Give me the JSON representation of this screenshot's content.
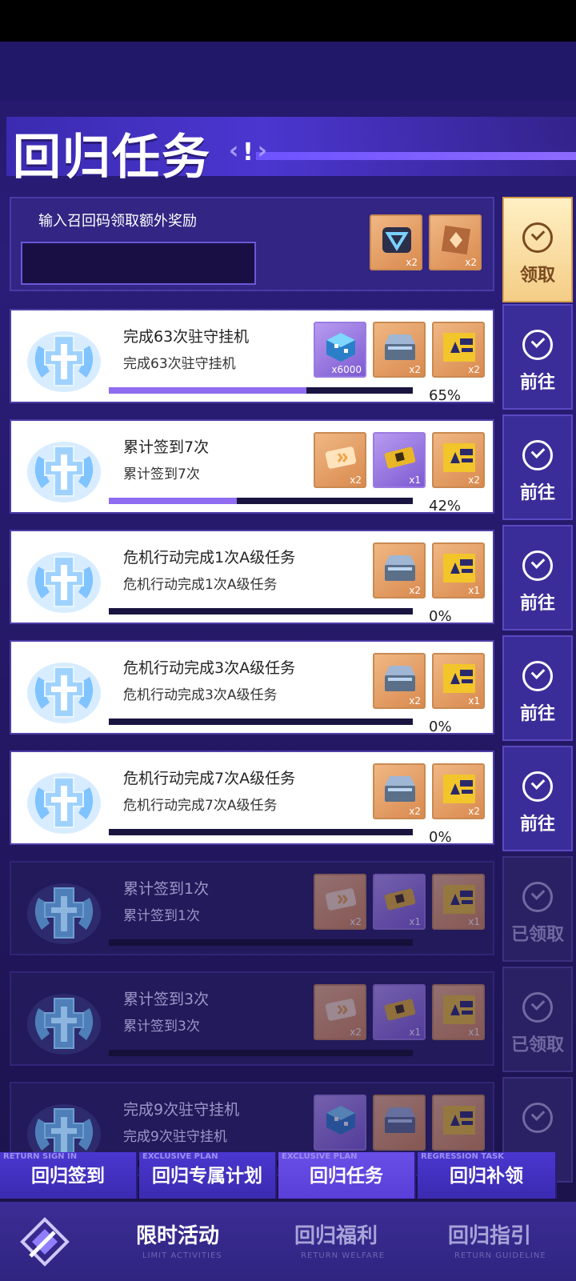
{
  "page": {
    "title": "回归任务",
    "title_icon": "exclamation-icon"
  },
  "code": {
    "label": "输入召回码领取额外奖励",
    "value": "",
    "placeholder": ""
  },
  "code_rewards": [
    {
      "icon": "crest-token-icon",
      "qty": "x2"
    },
    {
      "icon": "badge-card-icon",
      "qty": "x2"
    }
  ],
  "code_button": {
    "label": "领取"
  },
  "tasks": [
    {
      "title": "完成63次驻守挂机",
      "subtitle": "完成63次驻守挂机",
      "progress": 65,
      "percent": "65%",
      "done": false,
      "button": "前往",
      "rewards": [
        {
          "icon": "cube-crystal-icon",
          "qty": "x6000",
          "color": "purple"
        },
        {
          "icon": "chest-icon",
          "qty": "x2"
        },
        {
          "icon": "return-ticket-icon",
          "qty": "x2"
        }
      ]
    },
    {
      "title": "累计签到7次",
      "subtitle": "累计签到7次",
      "progress": 42,
      "percent": "42%",
      "done": false,
      "button": "前往",
      "rewards": [
        {
          "icon": "pass-card-icon",
          "qty": "x2"
        },
        {
          "icon": "gold-ticket-icon",
          "qty": "x1",
          "color": "purple"
        },
        {
          "icon": "return-ticket-icon",
          "qty": "x2"
        }
      ]
    },
    {
      "title": "危机行动完成1次A级任务",
      "subtitle": "危机行动完成1次A级任务",
      "progress": 0,
      "percent": "0%",
      "done": false,
      "button": "前往",
      "rewards": [
        {
          "icon": "chest-icon",
          "qty": "x2"
        },
        {
          "icon": "return-ticket-icon",
          "qty": "x1"
        }
      ]
    },
    {
      "title": "危机行动完成3次A级任务",
      "subtitle": "危机行动完成3次A级任务",
      "progress": 0,
      "percent": "0%",
      "done": false,
      "button": "前往",
      "rewards": [
        {
          "icon": "chest-icon",
          "qty": "x2"
        },
        {
          "icon": "return-ticket-icon",
          "qty": "x1"
        }
      ]
    },
    {
      "title": "危机行动完成7次A级任务",
      "subtitle": "危机行动完成7次A级任务",
      "progress": 0,
      "percent": "0%",
      "done": false,
      "button": "前往",
      "rewards": [
        {
          "icon": "chest-icon",
          "qty": "x2"
        },
        {
          "icon": "return-ticket-icon",
          "qty": "x2"
        }
      ]
    },
    {
      "title": "累计签到1次",
      "subtitle": "累计签到1次",
      "progress": 0,
      "percent": "",
      "done": true,
      "button": "已领取",
      "rewards": [
        {
          "icon": "pass-card-icon",
          "qty": "x2"
        },
        {
          "icon": "gold-ticket-icon",
          "qty": "x1",
          "color": "purple"
        },
        {
          "icon": "return-ticket-icon",
          "qty": "x1"
        }
      ]
    },
    {
      "title": "累计签到3次",
      "subtitle": "累计签到3次",
      "progress": 0,
      "percent": "",
      "done": true,
      "button": "已领取",
      "rewards": [
        {
          "icon": "pass-card-icon",
          "qty": "x2"
        },
        {
          "icon": "gold-ticket-icon",
          "qty": "x1",
          "color": "purple"
        },
        {
          "icon": "return-ticket-icon",
          "qty": "x1"
        }
      ]
    },
    {
      "title": "完成9次驻守挂机",
      "subtitle": "完成9次驻守挂机",
      "progress": 0,
      "percent": "",
      "done": true,
      "button": "",
      "rewards": [
        {
          "icon": "cube-crystal-icon",
          "qty": "",
          "color": "purple"
        },
        {
          "icon": "chest-icon",
          "qty": ""
        },
        {
          "icon": "return-ticket-icon",
          "qty": ""
        }
      ]
    }
  ],
  "subtabs": [
    {
      "label": "回归签到",
      "en": "RETURN SIGN IN",
      "active": false
    },
    {
      "label": "回归专属计划",
      "en": "EXCLUSIVE PLAN",
      "active": false
    },
    {
      "label": "回归任务",
      "en": "EXCLUSIVE PLAN",
      "active": true
    },
    {
      "label": "回归补领",
      "en": "REGRESSION TASK",
      "active": false
    }
  ],
  "bottomnav": [
    {
      "label": "限时活动",
      "sub": "LIMIT ACTIVITIES",
      "active": true
    },
    {
      "label": "回归福利",
      "sub": "RETURN WELFARE",
      "active": false
    },
    {
      "label": "回归指引",
      "sub": "RETURN GUIDELINE",
      "active": false
    }
  ],
  "colors": {
    "accent": "#4b36d0",
    "progress": "#8f6cf0",
    "claim": "#f4cd86"
  }
}
